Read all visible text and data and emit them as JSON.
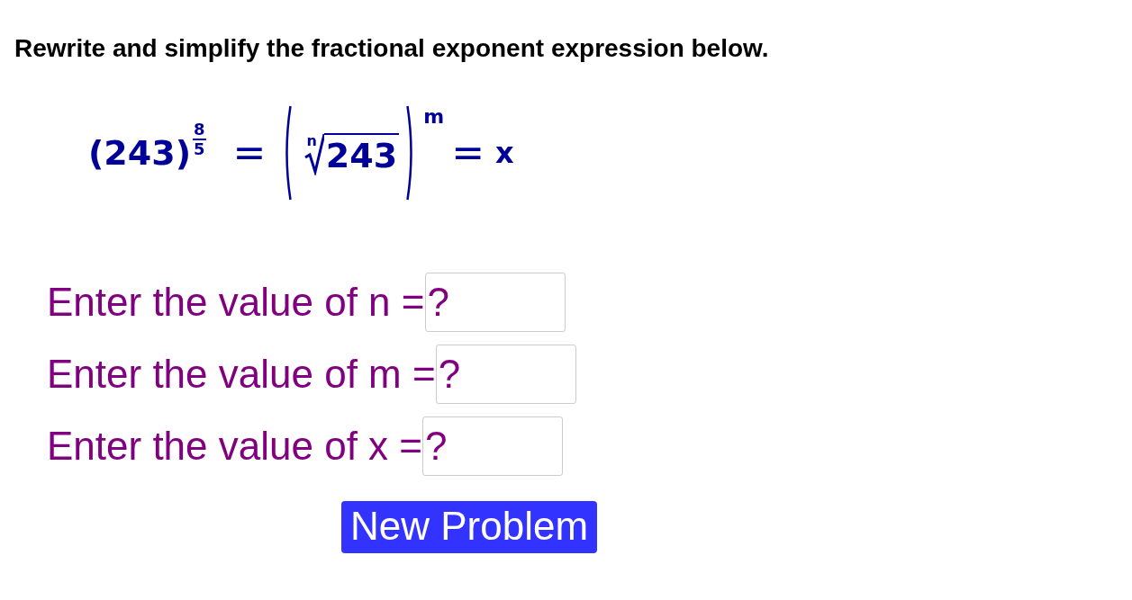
{
  "instruction": "Rewrite and simplify the fractional exponent expression below.",
  "formula": {
    "base": "(243)",
    "exponent_numerator": "8",
    "exponent_denominator": "5",
    "equals_sign": "=",
    "root_index": "n",
    "radicand": "243",
    "outer_exponent": "m",
    "second_equals_sign": "=",
    "result": "x"
  },
  "answers": [
    {
      "label": "Enter the value of n =",
      "placeholder": "?"
    },
    {
      "label": "Enter the value of m =",
      "placeholder": "?"
    },
    {
      "label": "Enter the value of x =",
      "placeholder": "?"
    }
  ],
  "button": "New Problem"
}
